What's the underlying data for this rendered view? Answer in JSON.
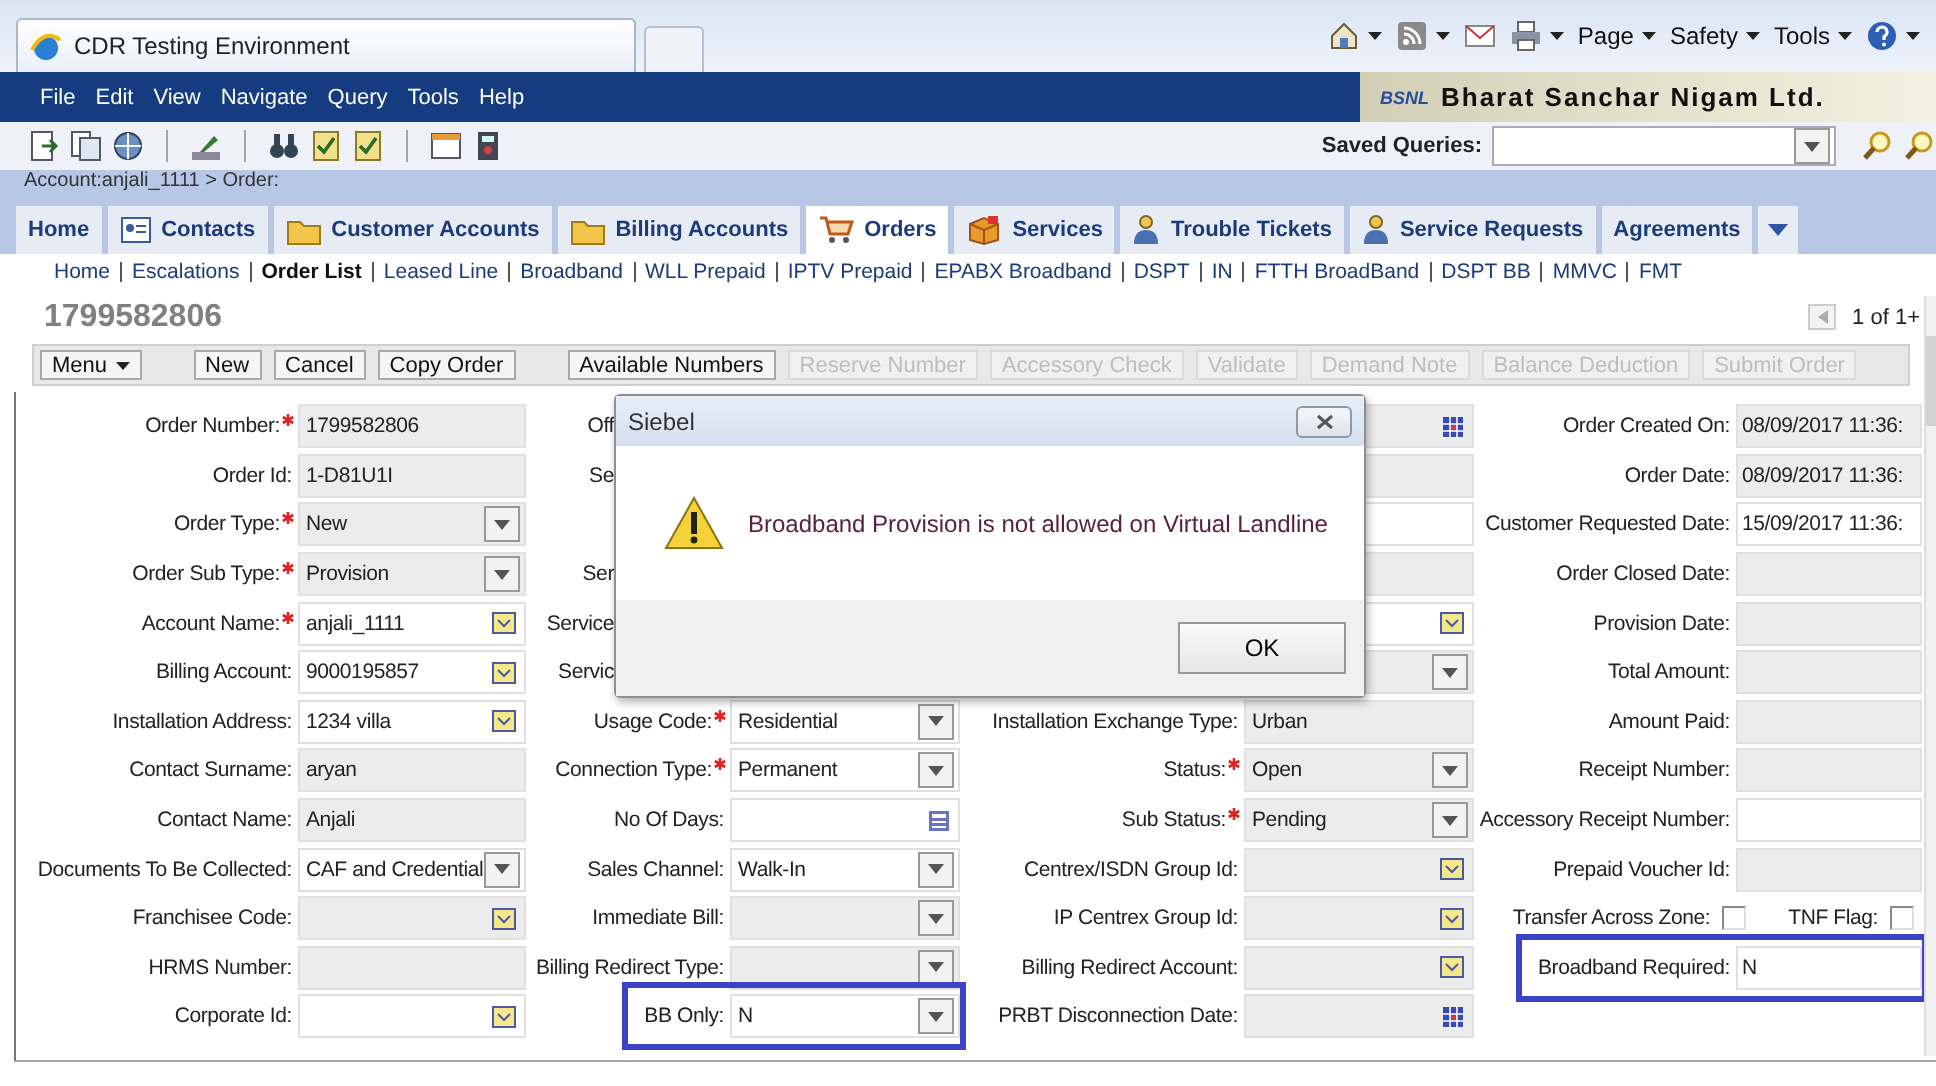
{
  "browser": {
    "tab_title": "CDR Testing Environment",
    "commands": [
      "Page",
      "Safety",
      "Tools"
    ]
  },
  "menu": [
    "File",
    "Edit",
    "View",
    "Navigate",
    "Query",
    "Tools",
    "Help"
  ],
  "logo": {
    "mark": "BSNL",
    "name": "Bharat Sanchar Nigam Ltd."
  },
  "toolbar": {
    "saved_queries_label": "Saved Queries:"
  },
  "breadcrumb": "Account:anjali_1111  > Order:",
  "tabs": [
    {
      "label": "Home",
      "kind": "plain",
      "selected": false
    },
    {
      "label": "Contacts",
      "kind": "card",
      "selected": false
    },
    {
      "label": "Customer Accounts",
      "kind": "folder",
      "selected": false
    },
    {
      "label": "Billing Accounts",
      "kind": "folder",
      "selected": false
    },
    {
      "label": "Orders",
      "kind": "cart",
      "selected": true
    },
    {
      "label": "Services",
      "kind": "box",
      "selected": false
    },
    {
      "label": "Trouble Tickets",
      "kind": "person",
      "selected": false
    },
    {
      "label": "Service Requests",
      "kind": "person",
      "selected": false
    },
    {
      "label": "Agreements",
      "kind": "plain",
      "selected": false
    }
  ],
  "subtabs": [
    {
      "label": "Home",
      "selected": false
    },
    {
      "label": "Escalations",
      "selected": false
    },
    {
      "label": "Order List",
      "selected": true
    },
    {
      "label": "Leased Line",
      "selected": false
    },
    {
      "label": "Broadband",
      "selected": false
    },
    {
      "label": "WLL Prepaid",
      "selected": false
    },
    {
      "label": "IPTV Prepaid",
      "selected": false
    },
    {
      "label": "EPABX Broadband",
      "selected": false
    },
    {
      "label": "DSPT",
      "selected": false
    },
    {
      "label": "IN",
      "selected": false
    },
    {
      "label": "FTTH BroadBand",
      "selected": false
    },
    {
      "label": "DSPT BB",
      "selected": false
    },
    {
      "label": "MMVC",
      "selected": false
    },
    {
      "label": "FMT",
      "selected": false
    }
  ],
  "record": {
    "title": "1799582806",
    "pager": "1 of 1+"
  },
  "buttons": [
    {
      "label": "Menu",
      "kind": "menu",
      "disabled": false
    },
    {
      "label": "New",
      "kind": "plain",
      "disabled": false
    },
    {
      "label": "Cancel",
      "kind": "plain",
      "disabled": false
    },
    {
      "label": "Copy Order",
      "kind": "plain",
      "disabled": false
    },
    {
      "label": "Available Numbers",
      "kind": "plain",
      "disabled": false
    },
    {
      "label": "Reserve Number",
      "kind": "plain",
      "disabled": true
    },
    {
      "label": "Accessory Check",
      "kind": "plain",
      "disabled": true
    },
    {
      "label": "Validate",
      "kind": "plain",
      "disabled": true
    },
    {
      "label": "Demand Note",
      "kind": "plain",
      "disabled": true
    },
    {
      "label": "Balance Deduction",
      "kind": "plain",
      "disabled": true
    },
    {
      "label": "Submit Order",
      "kind": "plain",
      "disabled": true
    }
  ],
  "form": {
    "rows": [
      {
        "kind": "covered",
        "cut_label": "Off",
        "fields": [
          {
            "label": "Order Number:",
            "required": true,
            "value": "1799582806",
            "kind": "text",
            "readonly": true
          },
          {
            "kind": "calendar",
            "readonly": true
          },
          {
            "label": "Order Created On:",
            "value": "08/09/2017 11:36:",
            "kind": "text",
            "readonly": true
          }
        ]
      },
      {
        "kind": "covered",
        "cut_label": "Se",
        "fields": [
          {
            "label": "Order Id:",
            "value": "1-D81U1I",
            "kind": "text",
            "readonly": true
          },
          {
            "kind": "text",
            "readonly": true
          },
          {
            "label": "Order Date:",
            "value": "08/09/2017 11:36:",
            "kind": "text",
            "readonly": true
          }
        ]
      },
      {
        "kind": "covered",
        "fields": [
          {
            "label": "Order Type:",
            "required": true,
            "value": "New",
            "kind": "select",
            "readonly": true
          },
          {
            "kind": "text",
            "readonly": false
          },
          {
            "label": "Customer Requested Date:",
            "value": "15/09/2017 11:36:",
            "kind": "text",
            "readonly": false
          }
        ]
      },
      {
        "kind": "covered",
        "cut_label": "Ser",
        "fields": [
          {
            "label": "Order Sub Type:",
            "required": true,
            "value": "Provision",
            "kind": "select",
            "readonly": true
          },
          {
            "kind": "text",
            "readonly": true
          },
          {
            "label": "Order Closed Date:",
            "kind": "text",
            "readonly": true
          }
        ]
      },
      {
        "kind": "covered",
        "cut_label": "Service",
        "fields": [
          {
            "label": "Account Name:",
            "required": true,
            "value": "anjali_1111",
            "kind": "picker",
            "readonly": false
          },
          {
            "kind": "picker",
            "readonly": false
          },
          {
            "label": "Provision Date:",
            "kind": "text",
            "readonly": true
          }
        ]
      },
      {
        "kind": "covered",
        "cut_label": "Servic",
        "fields": [
          {
            "label": "Billing Account:",
            "value": "9000195857",
            "kind": "picker",
            "readonly": false
          },
          {
            "kind": "select",
            "readonly": true
          },
          {
            "label": "Total Amount:",
            "kind": "text",
            "readonly": true
          }
        ]
      },
      {
        "fields": [
          {
            "label": "Installation Address:",
            "value": "1234 villa",
            "kind": "picker",
            "readonly": false
          },
          {
            "label": "Usage Code:",
            "required": true,
            "value": "Residential",
            "kind": "select",
            "readonly": false
          },
          {
            "label": "Installation Exchange Type:",
            "value": "Urban",
            "kind": "text",
            "readonly": true
          },
          {
            "label": "Amount Paid:",
            "kind": "text",
            "readonly": true
          }
        ]
      },
      {
        "fields": [
          {
            "label": "Contact Surname:",
            "value": "aryan",
            "kind": "text",
            "readonly": true
          },
          {
            "label": "Connection Type:",
            "required": true,
            "value": "Permanent",
            "kind": "select",
            "readonly": false
          },
          {
            "label": "Status:",
            "required": true,
            "value": "Open",
            "kind": "select",
            "readonly": true
          },
          {
            "label": "Receipt Number:",
            "kind": "text",
            "readonly": true
          }
        ]
      },
      {
        "fields": [
          {
            "label": "Contact Name:",
            "value": "Anjali",
            "kind": "text",
            "readonly": true
          },
          {
            "label": "No Of Days:",
            "kind": "calculator",
            "readonly": false
          },
          {
            "label": "Sub Status:",
            "required": true,
            "value": "Pending",
            "kind": "select",
            "readonly": true
          },
          {
            "label": "Accessory Receipt Number:",
            "kind": "text",
            "readonly": false
          }
        ]
      },
      {
        "fields": [
          {
            "label": "Documents To Be Collected:",
            "value": "CAF and Credential",
            "kind": "select",
            "readonly": false
          },
          {
            "label": "Sales Channel:",
            "value": "Walk-In",
            "kind": "select",
            "readonly": false
          },
          {
            "label": "Centrex/ISDN Group Id:",
            "kind": "picker",
            "readonly": true
          },
          {
            "label": "Prepaid Voucher Id:",
            "kind": "text",
            "readonly": true
          }
        ]
      },
      {
        "fields": [
          {
            "label": "Franchisee Code:",
            "kind": "picker",
            "readonly": true
          },
          {
            "label": "Immediate Bill:",
            "kind": "select",
            "readonly": true
          },
          {
            "label": "IP Centrex Group Id:",
            "kind": "picker",
            "readonly": true
          },
          {
            "kind": "checks",
            "items": [
              {
                "label": "Transfer Across Zone:",
                "checked": false
              },
              {
                "label": "TNF Flag:",
                "checked": false
              }
            ]
          }
        ]
      },
      {
        "fields": [
          {
            "label": "HRMS Number:",
            "kind": "text",
            "readonly": true
          },
          {
            "label": "Billing Redirect Type:",
            "kind": "select",
            "readonly": true
          },
          {
            "label": "Billing Redirect Account:",
            "kind": "picker",
            "readonly": true
          },
          {
            "label": "Broadband Required:",
            "value": "N",
            "kind": "text",
            "readonly": false,
            "highlighted": true
          }
        ]
      },
      {
        "fields": [
          {
            "label": "Corporate Id:",
            "kind": "picker",
            "readonly": false
          },
          {
            "label": "BB Only:",
            "value": "N",
            "kind": "select",
            "readonly": false,
            "highlighted": true
          },
          {
            "label": "PRBT Disconnection Date:",
            "kind": "calendar",
            "readonly": true
          }
        ]
      }
    ]
  },
  "dialog": {
    "title": "Siebel",
    "message": "Broadband Provision is not allowed on Virtual Landline",
    "button": "OK"
  }
}
